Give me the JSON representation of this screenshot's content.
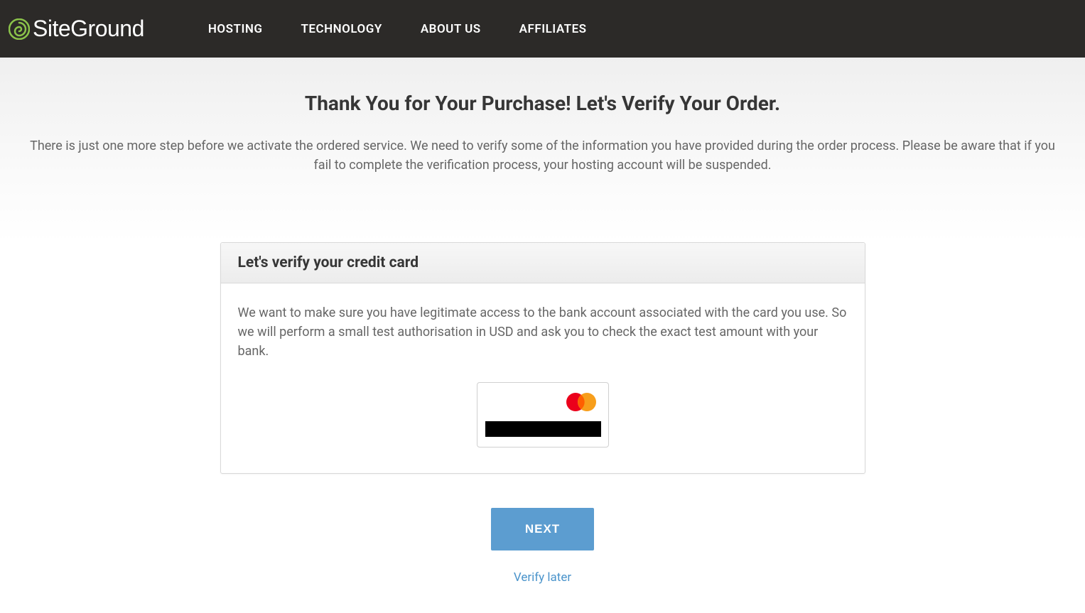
{
  "header": {
    "logo_text": "SiteGround",
    "nav": [
      {
        "label": "HOSTING"
      },
      {
        "label": "TECHNOLOGY"
      },
      {
        "label": "ABOUT US"
      },
      {
        "label": "AFFILIATES"
      }
    ]
  },
  "main": {
    "title": "Thank You for Your Purchase! Let's Verify Your Order.",
    "subtitle": "There is just one more step before we activate the ordered service. We need to verify some of the information you have provided during the order process. Please be aware that if you fail to complete the verification process, your hosting account will be suspended."
  },
  "card": {
    "title": "Let's verify your credit card",
    "body_text": "We want to make sure you have legitimate access to the bank account associated with the card you use. So we will perform a small test authorisation in USD and ask you to check the exact test amount with your bank."
  },
  "actions": {
    "next_label": "NEXT",
    "verify_later_label": "Verify later"
  }
}
